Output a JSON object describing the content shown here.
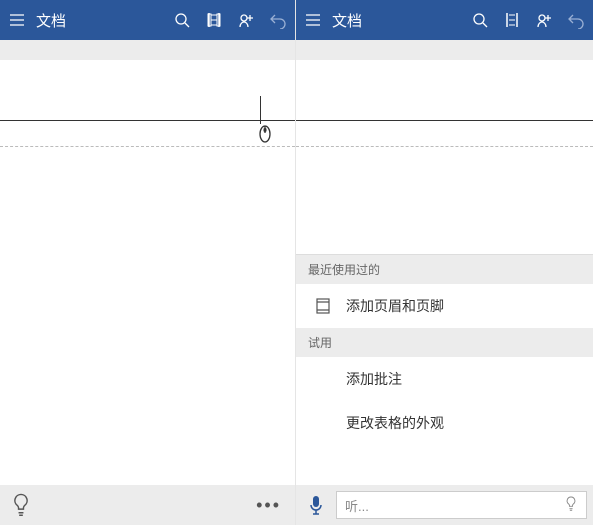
{
  "titlebar": {
    "title": "文档"
  },
  "panel": {
    "recent_header": "最近使用过的",
    "recent_items": [
      {
        "label": "添加页眉和页脚",
        "icon": "page-icon"
      }
    ],
    "try_header": "试用",
    "try_items": [
      {
        "label": "添加批注"
      },
      {
        "label": "更改表格的外观"
      }
    ]
  },
  "search": {
    "placeholder": "听..."
  }
}
